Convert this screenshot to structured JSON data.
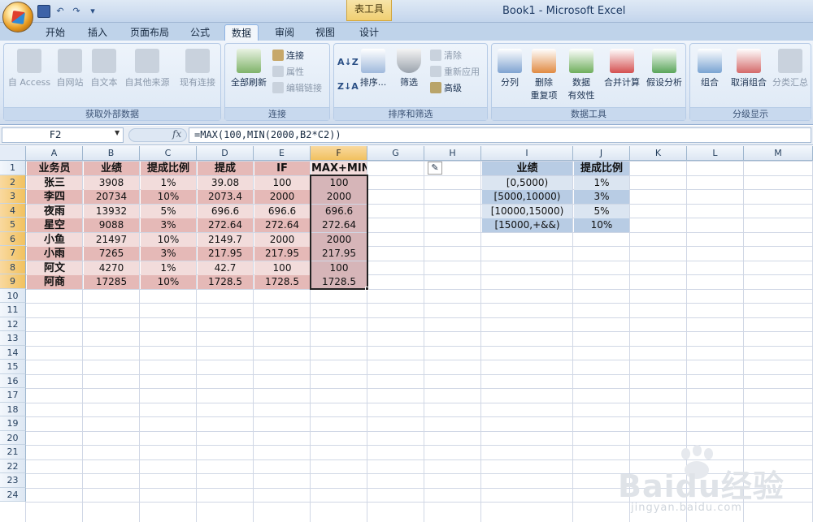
{
  "window": {
    "title": "Book1 - Microsoft Excel",
    "context_tab": "表工具"
  },
  "tabs": [
    {
      "label": "开始",
      "active": false
    },
    {
      "label": "插入",
      "active": false
    },
    {
      "label": "页面布局",
      "active": false
    },
    {
      "label": "公式",
      "active": false
    },
    {
      "label": "数据",
      "active": true
    },
    {
      "label": "审阅",
      "active": false
    },
    {
      "label": "视图",
      "active": false
    },
    {
      "label": "设计",
      "active": false
    }
  ],
  "ribbon": {
    "get_external": {
      "label": "获取外部数据",
      "buttons": [
        "自 Access",
        "自网站",
        "自文本",
        "自其他来源",
        "现有连接"
      ]
    },
    "connections": {
      "label": "连接",
      "refresh_all": "全部刷新",
      "connections": "连接",
      "properties": "属性",
      "edit_links": "编辑链接"
    },
    "sort_filter": {
      "label": "排序和筛选",
      "sort": "排序...",
      "filter": "筛选",
      "clear": "清除",
      "reapply": "重新应用",
      "advanced": "高级"
    },
    "data_tools": {
      "label": "数据工具",
      "text_to_columns": "分列",
      "remove_duplicates": "删除",
      "remove_duplicates2": "重复项",
      "validation": "数据",
      "validation2": "有效性",
      "consolidate": "合并计算",
      "what_if": "假设分析"
    },
    "outline": {
      "label": "分级显示",
      "group": "组合",
      "ungroup": "取消组合",
      "subtotal": "分类汇总"
    }
  },
  "formula_bar": {
    "name_box": "F2",
    "fx": "fx",
    "formula": "=MAX(100,MIN(2000,B2*C2))"
  },
  "columns": [
    "A",
    "B",
    "C",
    "D",
    "E",
    "F",
    "G",
    "H",
    "I",
    "J",
    "K",
    "L",
    "M"
  ],
  "rows": [
    "1",
    "2",
    "3",
    "4",
    "5",
    "6",
    "7",
    "8",
    "9",
    "10",
    "11",
    "12",
    "13",
    "14",
    "15",
    "16",
    "17",
    "18",
    "19",
    "20",
    "21",
    "22",
    "23",
    "24"
  ],
  "table": {
    "headers": [
      "业务员",
      "业绩",
      "提成比例",
      "提成",
      "IF",
      "MAX+MIN"
    ],
    "rows": [
      [
        "张三",
        "3908",
        "1%",
        "39.08",
        "100",
        "100"
      ],
      [
        "李四",
        "20734",
        "10%",
        "2073.4",
        "2000",
        "2000"
      ],
      [
        "夜雨",
        "13932",
        "5%",
        "696.6",
        "696.6",
        "696.6"
      ],
      [
        "星空",
        "9088",
        "3%",
        "272.64",
        "272.64",
        "272.64"
      ],
      [
        "小鱼",
        "21497",
        "10%",
        "2149.7",
        "2000",
        "2000"
      ],
      [
        "小雨",
        "7265",
        "3%",
        "217.95",
        "217.95",
        "217.95"
      ],
      [
        "阿文",
        "4270",
        "1%",
        "42.7",
        "100",
        "100"
      ],
      [
        "阿商",
        "17285",
        "10%",
        "1728.5",
        "1728.5",
        "1728.5"
      ]
    ]
  },
  "lookup": {
    "headers": [
      "业绩",
      "提成比例"
    ],
    "rows": [
      [
        "[0,5000)",
        "1%"
      ],
      [
        "[5000,10000)",
        "3%"
      ],
      [
        "[10000,15000)",
        "5%"
      ],
      [
        "[15000,+&&)",
        "10%"
      ]
    ]
  },
  "watermark": {
    "logo": "Baidu经验",
    "url": "jingyan.baidu.com"
  }
}
